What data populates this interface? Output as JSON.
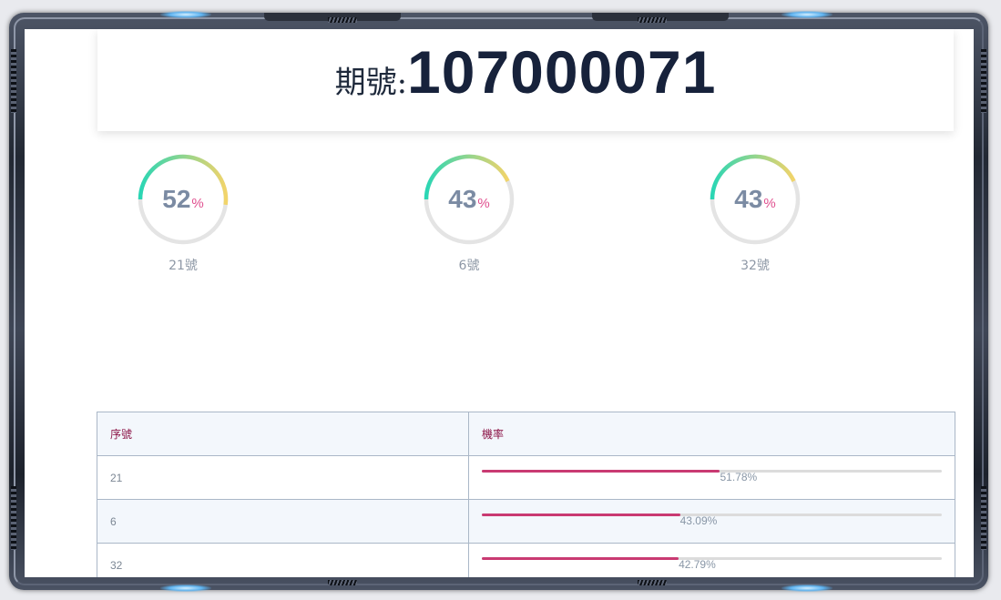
{
  "period": {
    "label": "期號:",
    "number": "107000071"
  },
  "gauges": [
    {
      "value": 52,
      "unit": "%",
      "label": "21號"
    },
    {
      "value": 43,
      "unit": "%",
      "label": "6號"
    },
    {
      "value": 43,
      "unit": "%",
      "label": "32號"
    }
  ],
  "colors": {
    "gauge_gradient_start": "#2ad6b4",
    "gauge_gradient_end": "#f2d46a",
    "gauge_track": "#e4e4e4",
    "bar_fill": "#c93a72",
    "bar_track": "#dcdcdc",
    "header_text": "#8b1346",
    "percent_sign": "#e0508f"
  },
  "table": {
    "headers": {
      "index": "序號",
      "probability": "機率"
    },
    "rows": [
      {
        "index": "21",
        "probability": "51.78%",
        "value": 51.78
      },
      {
        "index": "6",
        "probability": "43.09%",
        "value": 43.09
      },
      {
        "index": "32",
        "probability": "42.79%",
        "value": 42.79
      }
    ]
  }
}
